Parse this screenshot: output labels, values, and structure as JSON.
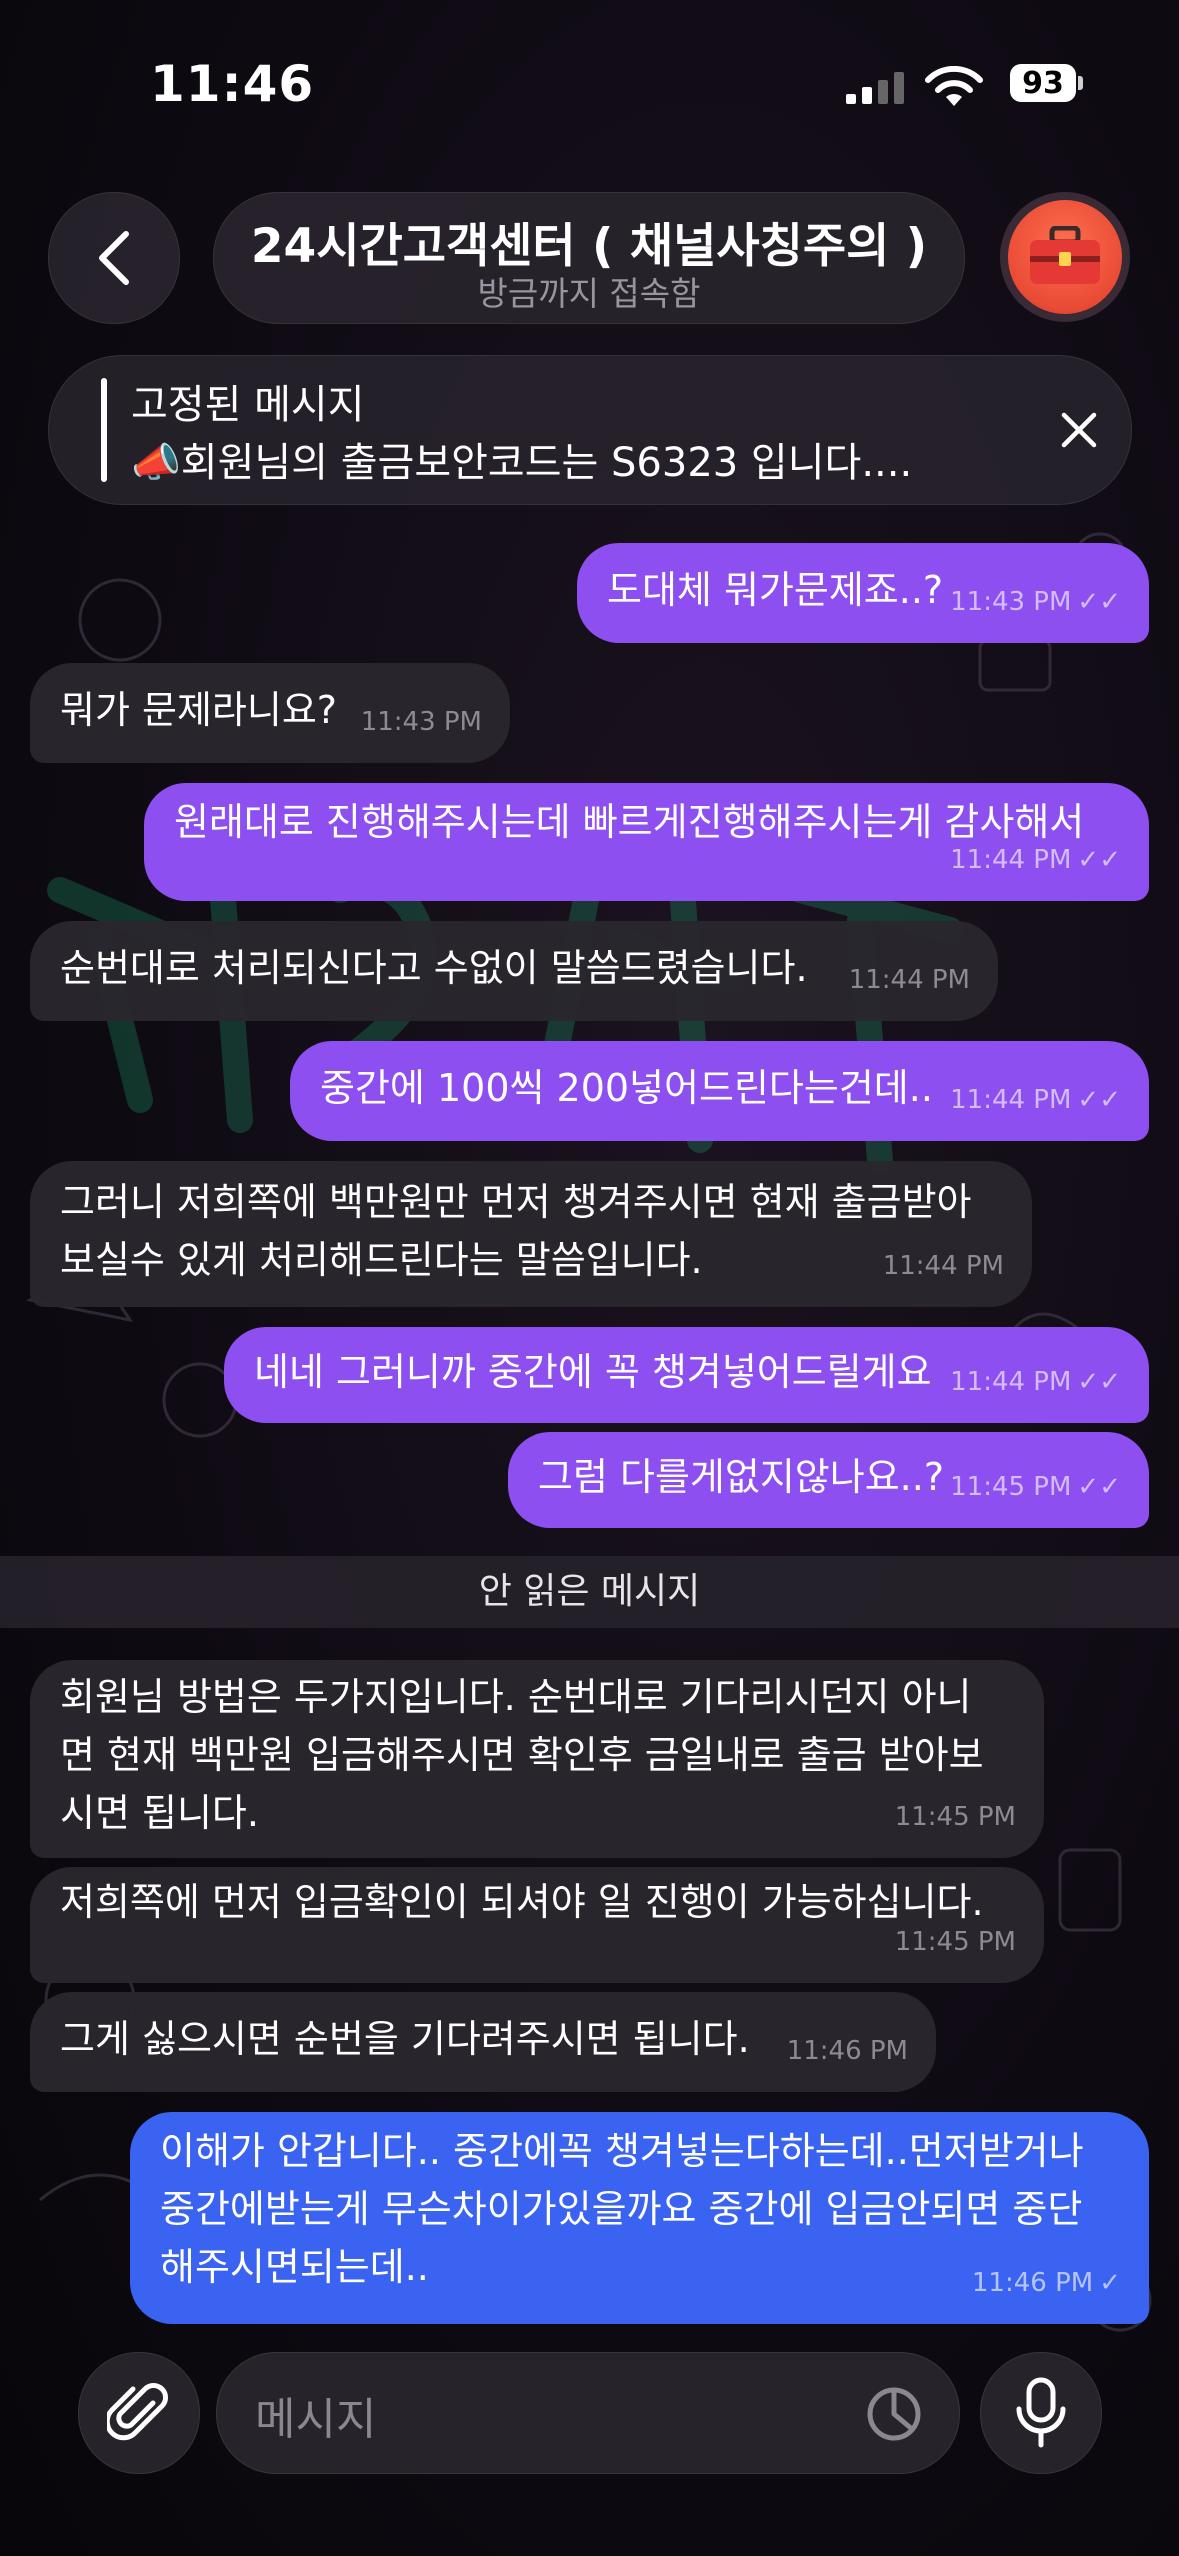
{
  "status_bar": {
    "time": "11:46",
    "battery": "93"
  },
  "header": {
    "title": "24시간고객센터 ( 채널사칭주의 )",
    "subtitle": "방금까지 접속함"
  },
  "pinned": {
    "title": "고정된 메시지",
    "text": "📣회원님의 출금보안코드는 S6323 입니다...."
  },
  "messages": [
    {
      "dir": "out",
      "text": "도대체 뭐가문제죠..?",
      "time": "11:43 PM"
    },
    {
      "dir": "in",
      "text": "뭐가 문제라니요?",
      "time": "11:43 PM"
    },
    {
      "dir": "out",
      "text": "원래대로 진행해주시는데 빠르게진행해주시는게 감사해서",
      "time": "11:44 PM"
    },
    {
      "dir": "in",
      "text": "순번대로 처리되신다고 수없이 말씀드렸습니다.",
      "time": "11:44 PM"
    },
    {
      "dir": "out",
      "text": "중간에 100씩 200넣어드린다는건데..",
      "time": "11:44 PM"
    },
    {
      "dir": "in",
      "text": "그러니 저희쪽에 백만원만 먼저 챙겨주시면 현재 출금받아\n보실수 있게 처리해드린다는 말씀입니다.",
      "time": "11:44 PM"
    },
    {
      "dir": "out",
      "text": "네네 그러니까 중간에 꼭 챙겨넣어드릴게요",
      "time": "11:44 PM"
    },
    {
      "dir": "out",
      "text": "그럼 다를게없지않나요..?",
      "time": "11:45 PM"
    },
    {
      "dir": "in",
      "text": "회원님 방법은 두가지입니다. 순번대로 기다리시던지 아니\n면 현재 백만원 입금해주시면 확인후 금일내로 출금 받아보\n시면 됩니다.",
      "time": "11:45 PM"
    },
    {
      "dir": "in",
      "text": "저희쪽에 먼저 입금확인이 되셔야 일 진행이 가능하십니다.",
      "time": "11:45 PM"
    },
    {
      "dir": "in",
      "text": "그게 싫으시면 순번을 기다려주시면 됩니다.",
      "time": "11:46 PM"
    },
    {
      "dir": "out",
      "text": "이해가 안갑니다.. 중간에꼭 챙겨넣는다하는데..먼저받거나\n중간에받는게 무슨차이가있을까요 중간에 입금안되면 중단\n해주시면되는데..",
      "time": "11:46 PM"
    }
  ],
  "unread_divider": "안 읽은 메시지",
  "input": {
    "placeholder": "메시지"
  },
  "colors": {
    "outgoing": "#8d4ff0",
    "outgoing_latest": "#3b63f2",
    "incoming": "#2a262e",
    "background": "#0e0a12"
  }
}
